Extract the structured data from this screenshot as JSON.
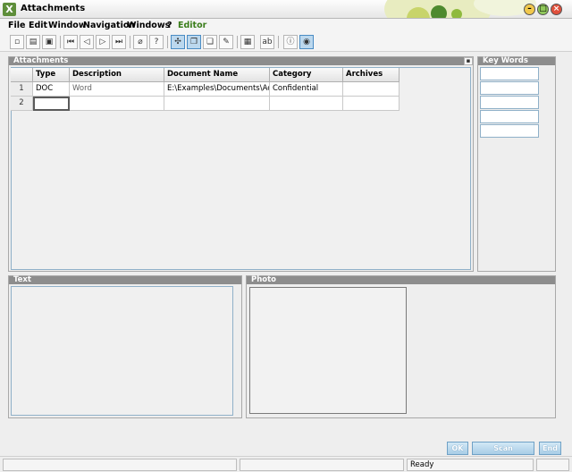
{
  "window": {
    "title": "Attachments",
    "app_icon_glyph": "X"
  },
  "menu": [
    {
      "label": "File"
    },
    {
      "label": "Edit"
    },
    {
      "label": "Window"
    },
    {
      "label": "Navigation"
    },
    {
      "label": "Windows"
    },
    {
      "label": "?"
    },
    {
      "label": "Editor"
    }
  ],
  "toolbar": {
    "icons": [
      "new-icon",
      "print-icon",
      "print-preview-icon",
      "first-record-icon",
      "previous-record-icon",
      "next-record-icon",
      "last-record-icon",
      "attach-icon",
      "help-icon",
      "link-icon",
      "copy-icon",
      "paste-icon",
      "edit-icon",
      "grid-icon",
      "text-icon",
      "info-icon",
      "globe-icon"
    ],
    "text_label": "ab"
  },
  "attachments": {
    "title": "Attachments",
    "columns": [
      "Type",
      "Description",
      "Document Name",
      "Category",
      "Archives"
    ],
    "rows": [
      {
        "num": "1",
        "type": "DOC",
        "description": "Word",
        "document_name": "E:\\Examples\\Documents\\Acc",
        "category": "Confidential",
        "archives": ""
      },
      {
        "num": "2",
        "type": "",
        "description": "",
        "document_name": "",
        "category": "",
        "archives": ""
      }
    ]
  },
  "keywords": {
    "title": "Key Words"
  },
  "text_panel": {
    "title": "Text"
  },
  "photo_panel": {
    "title": "Photo"
  },
  "buttons": {
    "ok": "OK",
    "scan": "Scan Document",
    "end": "End"
  },
  "status": {
    "text": "Ready"
  },
  "colors": {
    "accent": "#a8cde6",
    "header": "#8d8d8d",
    "brand_green": "#5e8e3a"
  }
}
